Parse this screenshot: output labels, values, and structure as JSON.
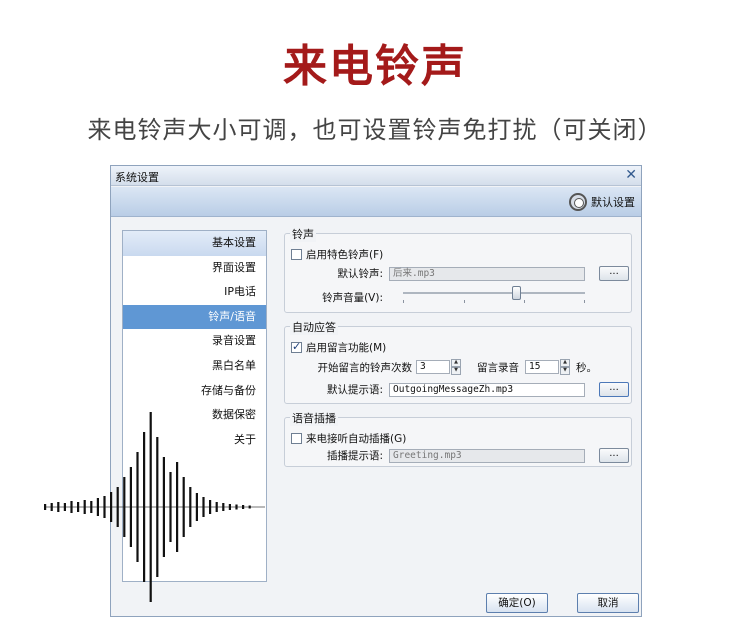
{
  "headline": "来电铃声",
  "subline": "来电铃声大小可调，也可设置铃声免打扰（可关闭）",
  "window": {
    "title": "系统设置",
    "close_glyph": "✕",
    "default_settings_label": "默认设置"
  },
  "nav": {
    "items": [
      {
        "label": "基本设置"
      },
      {
        "label": "界面设置"
      },
      {
        "label": "IP电话"
      },
      {
        "label": "铃声/语音"
      },
      {
        "label": "录音设置"
      },
      {
        "label": "黑白名单"
      },
      {
        "label": "存储与备份"
      },
      {
        "label": "数据保密"
      },
      {
        "label": "关于"
      }
    ],
    "active_index": 3
  },
  "ringtone": {
    "group_title": "铃声",
    "enable_special_label": "启用特色铃声(F)",
    "enable_special_checked": false,
    "default_ring_label": "默认铃声:",
    "default_ring_value": "后来.mp3",
    "browse_glyph": "...",
    "volume_label": "铃声音量(V):",
    "volume_level": 0.62
  },
  "auto_answer": {
    "group_title": "自动应答",
    "enable_message_label": "启用留言功能(M)",
    "enable_message_checked": true,
    "start_rings_label": "开始留言的铃声次数",
    "start_rings_value": "3",
    "record_label": "留言录音",
    "record_value": "15",
    "seconds_label": "秒。",
    "prompt_label": "默认提示语:",
    "prompt_value": "OutgoingMessageZh.mp3",
    "browse_glyph": "..."
  },
  "voice_insert": {
    "group_title": "语音插播",
    "auto_insert_label": "来电接听自动插播(G)",
    "auto_insert_checked": false,
    "insert_prompt_label": "插播提示语:",
    "insert_prompt_value": "Greeting.mp3",
    "browse_glyph": "..."
  },
  "footer": {
    "ok_label": "确定(O)",
    "cancel_label": "取消"
  },
  "colors": {
    "headline": "#a41a1a",
    "nav_active": "#5f97d4"
  }
}
